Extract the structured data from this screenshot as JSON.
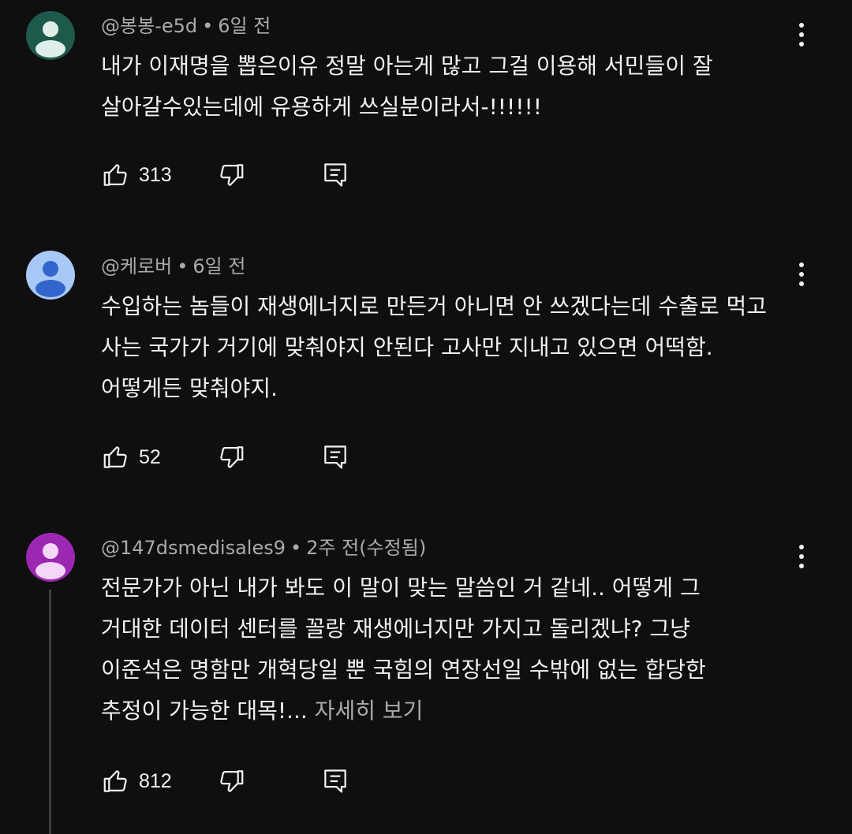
{
  "comments": [
    {
      "author": "@봉봉-e5d",
      "separator": "•",
      "time": "6일 전",
      "text": "내가 이재명을 뽑은이유 정말 아는게 많고 그걸 이용해 서민들이 잘 살아갈수있는데에 유용하게 쓰실분이라서-!!!!!!",
      "more": "",
      "likes": "313",
      "avatar_color": "#1e5a4b",
      "avatar_fg": "#dfeee9"
    },
    {
      "author": "@케로버",
      "separator": "•",
      "time": "6일 전",
      "text": "수입하는 놈들이 재생에너지로 만든거 아니면 안 쓰겠다는데 수출로 먹고 사는 국가가 거기에 맞춰야지 안된다 고사만 지내고 있으면 어떡함. 어떻게든 맞춰야지.",
      "more": "",
      "likes": "52",
      "avatar_color": "#a8c8f8",
      "avatar_fg": "#3366cc"
    },
    {
      "author": "@147dsmedisales9",
      "separator": "•",
      "time": "2주 전(수정됨)",
      "text": "전문가가 아닌 내가 봐도 이 말이 맞는 말씀인 거 같네.. 어떻게 그 거대한 데이터 센터를 꼴랑 재생에너지만 가지고 돌리겠냐? 그냥 이준석은 명함만 개혁당일 뿐 국힘의 연장선일 수밖에 없는 합당한 추정이 가능한 대목!...",
      "more": " 자세히 보기",
      "likes": "812",
      "avatar_color": "#9c27b0",
      "avatar_fg": "#f3d6f8"
    }
  ],
  "icons": {
    "like": "thumbs-up-icon",
    "dislike": "thumbs-down-icon",
    "reply": "reply-icon",
    "menu": "more-vertical-icon"
  }
}
